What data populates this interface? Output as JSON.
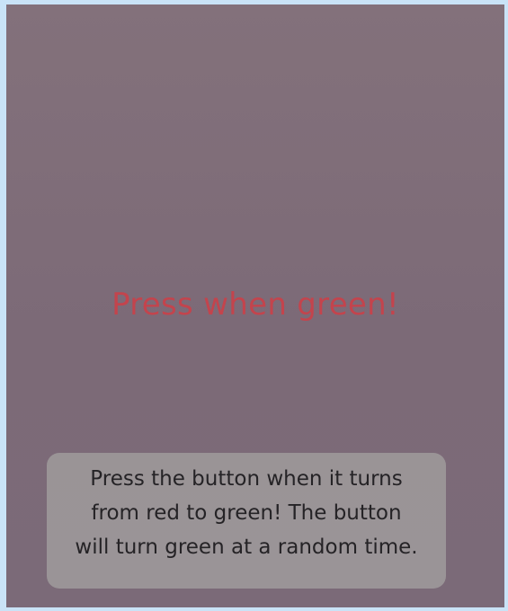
{
  "game": {
    "button_label": "Press when green!",
    "instructions": {
      "line1": "Press the button when it turns",
      "line2": "from red to green! The button",
      "line3": "will turn green at a random time."
    }
  },
  "colors": {
    "background": "#7f6d79",
    "button_text": "#c3444d",
    "instructions_box": "#a19d9d",
    "frame": "#c9e3f7"
  }
}
